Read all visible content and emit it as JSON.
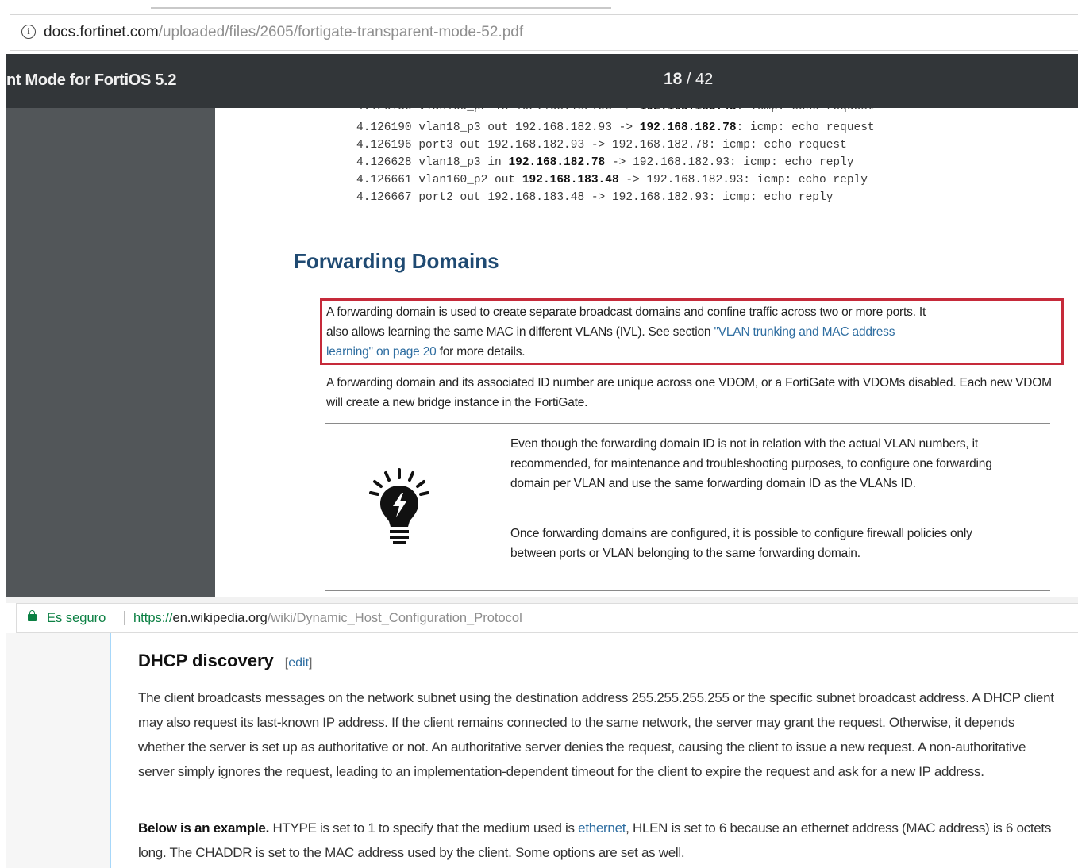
{
  "pdf_browser": {
    "address_host": "docs.fortinet.com",
    "address_path": "/uploaded/files/2605/fortigate-transparent-mode-52.pdf",
    "doc_title": "nt Mode for FortiOS 5.2",
    "current_page": "18",
    "page_separator": "/",
    "total_pages": "42"
  },
  "pdf_page": {
    "code_lines": [
      {
        "pre": "4.126190 vlan18_p3 out 192.168.182.93 -> ",
        "bold": "192.168.182.78",
        "post": ": icmp: echo request"
      },
      {
        "pre": "4.126196 port3 out 192.168.182.93 -> 192.168.182.78: icmp: echo request",
        "bold": "",
        "post": ""
      },
      {
        "pre": "4.126628 vlan18_p3 in ",
        "bold": "192.168.182.78",
        "post": " -> 192.168.182.93: icmp: echo reply"
      },
      {
        "pre": "4.126661 vlan160_p2 out ",
        "bold": "192.168.183.48",
        "post": " -> 192.168.182.93: icmp: echo reply"
      },
      {
        "pre": "4.126667 port2 out 192.168.183.48 -> 192.168.182.93: icmp: echo reply",
        "bold": "",
        "post": ""
      }
    ],
    "heading": "Forwarding Domains",
    "para1_line1": "A forwarding domain is used to create separate broadcast domains and confine traffic across two or more ports. It",
    "para1_line2_text": "also allows learning the same MAC in different VLANs (IVL). See section ",
    "para1_line2_link": "\"VLAN trunking and MAC address",
    "para1_line3_link": "learning\" on page 20",
    "para1_line3_text": " for more details.",
    "para2": "A forwarding domain and its associated ID number are unique across one VDOM, or a FortiGate with VDOMs disabled. Each new VDOM will create a new bridge instance in the FortiGate.",
    "note1": "Even though the forwarding domain ID is not in relation with the actual VLAN numbers, it recommended, for maintenance and troubleshooting purposes, to configure one forwarding domain per VLAN and use the same forwarding domain ID as the VLANs ID.",
    "note2": "Once forwarding domains are configured, it is possible to configure firewall policies only between ports or VLAN belonging to the same forwarding domain."
  },
  "wiki_browser": {
    "secure_label": "Es seguro",
    "url_scheme": "https://",
    "url_domain": "en.wikipedia.org",
    "url_path": "/wiki/Dynamic_Host_Configuration_Protocol"
  },
  "wiki_page": {
    "heading": "DHCP discovery",
    "edit_open": "[",
    "edit_label": "edit",
    "edit_close": "]",
    "para1": "The client broadcasts messages on the network subnet using the destination address 255.255.255.255 or the specific subnet broadcast address. A DHCP client may also request its last-known IP address. If the client remains connected to the same network, the server may grant the request. Otherwise, it depends whether the server is set up as authoritative or not. An authoritative server denies the request, causing the client to issue a new request. A non-authoritative server simply ignores the request, leading to an implementation-dependent timeout for the client to expire the request and ask for a new IP address.",
    "para2_bold": "Below is an example.",
    "para2_a": " HTYPE is set to 1 to specify that the medium used is ",
    "para2_link": "ethernet",
    "para2_b": ", HLEN is set to 6 because an ethernet address (MAC address) is 6 octets long. The CHADDR is set to the MAC address used by the client. Some options are set as well."
  },
  "colors": {
    "pdf_toolbar": "#323639",
    "pdf_sidebar": "#525659",
    "heading_blue": "#1f4a72",
    "highlight_red": "#c62a3a",
    "link_blue": "#2f6ea1",
    "secure_green": "#0b8043"
  },
  "icons": [
    "info-icon",
    "lightbulb-icon",
    "lock-icon"
  ]
}
